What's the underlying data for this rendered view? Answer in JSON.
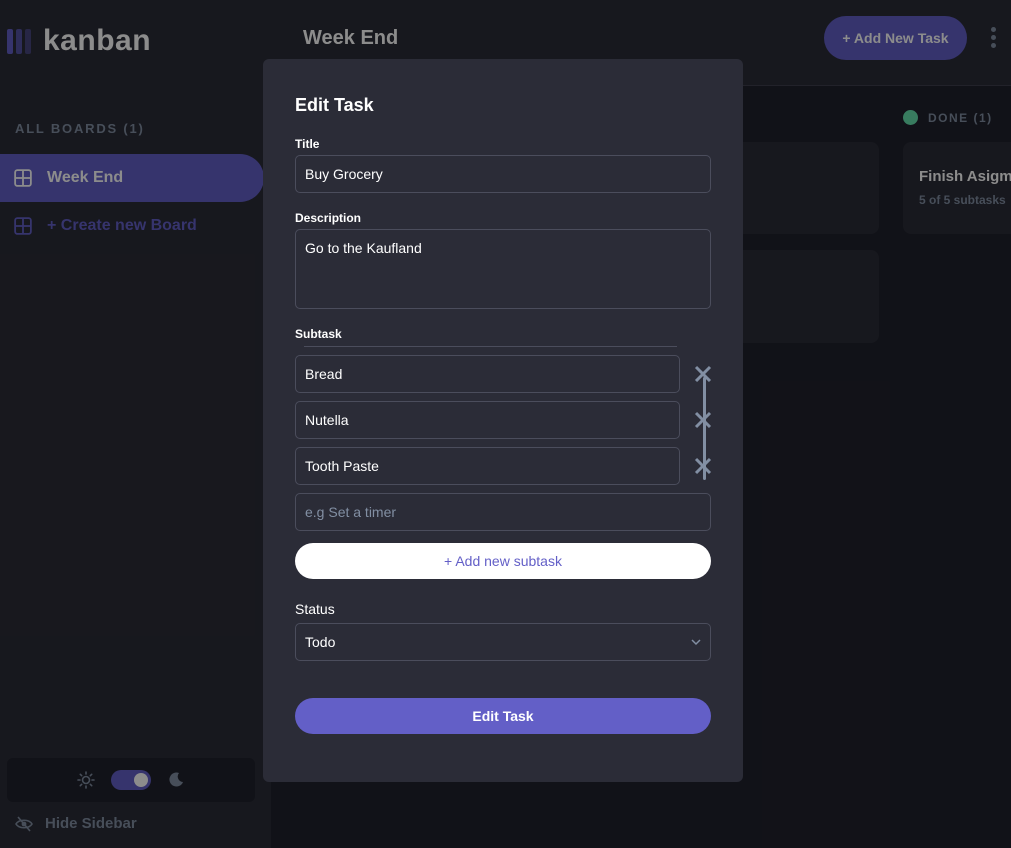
{
  "app": {
    "logo_text": "kanban"
  },
  "sidebar": {
    "all_boards_label": "ALL BOARDS (1)",
    "boards": [
      {
        "label": "Week End",
        "active": true
      }
    ],
    "create_board_label": "+ Create new Board",
    "hide_sidebar_label": "Hide Sidebar",
    "theme": "dark"
  },
  "header": {
    "board_title": "Week End",
    "add_task_label": "+ Add New Task"
  },
  "board": {
    "columns": [
      {
        "name": "DONE (1)",
        "dot_color": "#67e2ae"
      }
    ],
    "cards": [
      {
        "title": "Finish Asigm",
        "subtasks_text": "5 of 5 subtasks"
      }
    ]
  },
  "modal": {
    "title": "Edit Task",
    "title_label": "Title",
    "title_value": "Buy Grocery",
    "description_label": "Description",
    "description_value": "Go to the Kaufland",
    "subtask_label": "Subtask",
    "subtasks": [
      "Bread",
      "Nutella",
      "Tooth Paste"
    ],
    "new_subtask_placeholder": "e.g Set a timer",
    "add_subtask_label": "+ Add new subtask",
    "status_label": "Status",
    "status_value": "Todo",
    "submit_label": "Edit Task"
  },
  "colors": {
    "accent": "#635fc7",
    "sidebar_bg": "#2b2c37",
    "board_bg": "#20212c",
    "muted_text": "#828fa3",
    "done_dot": "#67e2ae"
  }
}
